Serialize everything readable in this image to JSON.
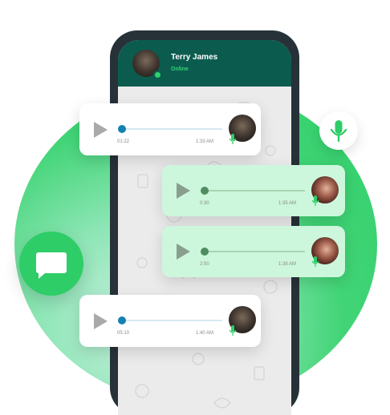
{
  "contact": {
    "name": "Terry James",
    "status": "Online"
  },
  "messages": [
    {
      "direction": "incoming",
      "duration": "01:22",
      "time": "1:33 AM"
    },
    {
      "direction": "outgoing",
      "duration": "0:30",
      "time": "1:35 AM"
    },
    {
      "direction": "outgoing",
      "duration": "2:50",
      "time": "1:38 AM"
    },
    {
      "direction": "incoming",
      "duration": "05:10",
      "time": "1:40 AM"
    }
  ],
  "icons": {
    "play": "play-icon",
    "mic": "microphone-icon",
    "chat": "chat-bubble-icon",
    "online": "online-status-dot"
  },
  "colors": {
    "header": "#0b5c4f",
    "accent": "#2ecd67",
    "online_text": "#34d36f",
    "incoming_bubble": "#ffffff",
    "outgoing_bubble": "#ccf7dc",
    "progress_knob_incoming": "#1480b3",
    "progress_knob_outgoing": "#4f8d61"
  }
}
